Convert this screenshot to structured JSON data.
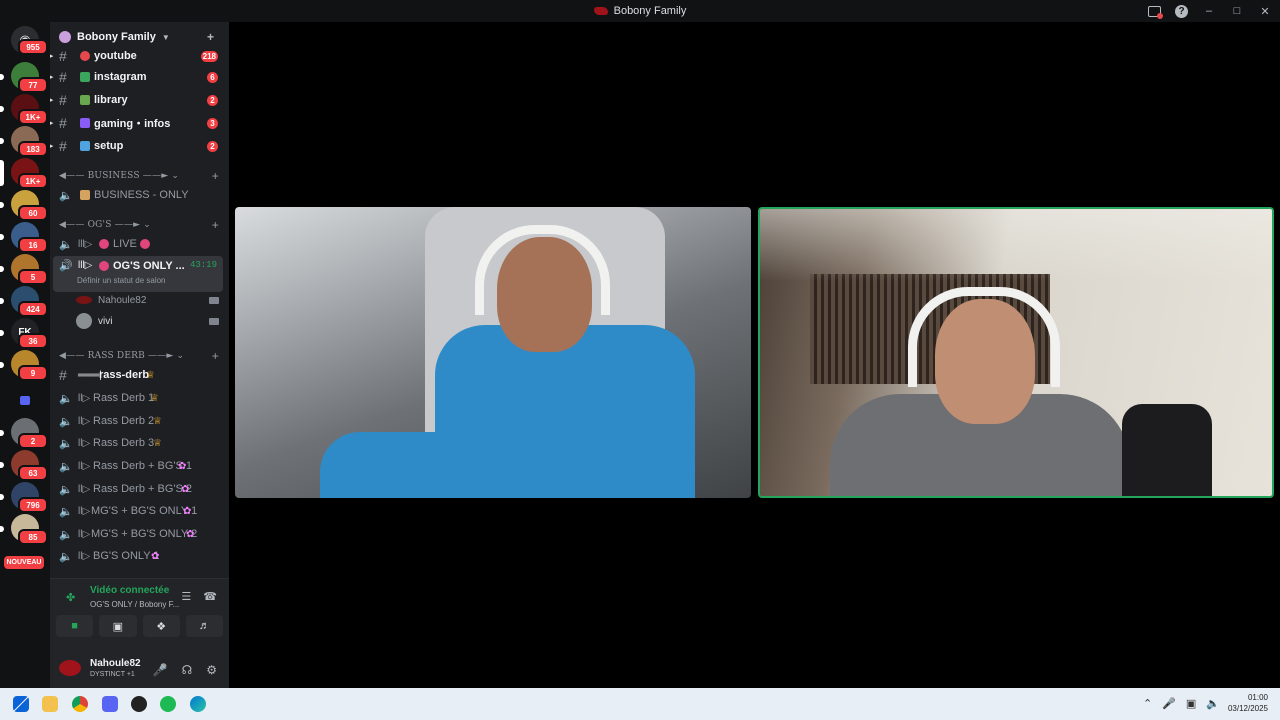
{
  "window": {
    "title": "Bobony Family"
  },
  "rail": {
    "badges": [
      "955",
      "77",
      "1K+",
      "183",
      "1K+",
      "60",
      "16",
      "5",
      "424",
      "36",
      "9",
      "2",
      "63",
      "796",
      "85"
    ],
    "new_label": "NOUVEAU"
  },
  "guild": {
    "name": "Bobony Family"
  },
  "channels": {
    "top": [
      {
        "label": "youtube",
        "count": "218"
      },
      {
        "label": "instagram",
        "count": "6"
      },
      {
        "label": "library",
        "count": "2"
      },
      {
        "label": "gaming・infos",
        "count": "3"
      },
      {
        "label": "setup",
        "count": "2"
      }
    ],
    "business": {
      "category": "BUSINESS",
      "channel": "BUSINESS - ONLY"
    },
    "ogs": {
      "category": "OG'S",
      "live": "LIVE",
      "active": "OG'S ONLY ...",
      "timer": "43:19",
      "status_hint": "Définir un statut de salon",
      "users": [
        "Nahoule82",
        "vivi"
      ]
    },
    "rass": {
      "category": "RASS DERB",
      "items": [
        "rass-derb",
        "Rass Derb 1",
        "Rass Derb 2",
        "Rass Derb 3",
        "Rass Derb + BG'S 1",
        "Rass Derb + BG'S 2",
        "MG'S + BG'S ONLY 1",
        "MG'S + BG'S ONLY 2",
        "BG'S ONLY 1"
      ]
    }
  },
  "voice_panel": {
    "status": "Vidéo connectée",
    "sub": "OG'S ONLY  / Bobony F...",
    "user": "Nahoule82",
    "user_status": "DYSTINCT +1"
  },
  "clock": {
    "time": "01:00",
    "date": "03/12/2025"
  },
  "colors": {
    "accent_green": "#23a55a",
    "badge_red": "#f23f43"
  }
}
